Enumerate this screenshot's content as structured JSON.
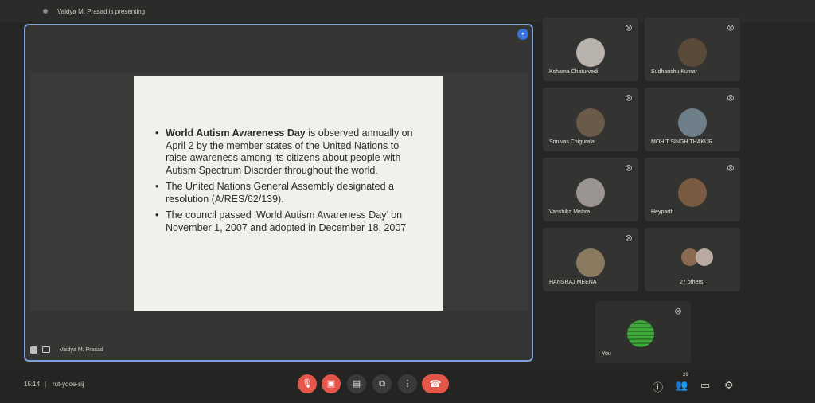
{
  "header": {
    "presenting_text": "Vaidya M. Prasad is presenting"
  },
  "presentation": {
    "badge_text": "+",
    "bullets": [
      {
        "bold": "World Autism Awareness Day",
        "text": " is observed annually on April 2 by the member states of the United Nations to raise awareness among its citizens about people with Autism Spectrum Disorder throughout the world."
      },
      {
        "bold": "",
        "text": "The United Nations General Assembly designated a resolution (A/RES/62/139)."
      },
      {
        "bold": "",
        "text": "The council passed ‘World Autism Awareness Day’ on November 1, 2007 and adopted in December 18, 2007"
      }
    ],
    "presenter_name": "Vaidya M. Prasad"
  },
  "participants": [
    {
      "name": "Kshama Chaturvedi",
      "avatar_color": "#b8b2ac"
    },
    {
      "name": "Sudhanshu Kumar",
      "avatar_color": "#5a4a3a"
    },
    {
      "name": "Srinivas Chigurala",
      "avatar_color": "#6a5a4a"
    },
    {
      "name": "MOHIT SINGH THAKUR",
      "avatar_color": "#6f7f8a"
    },
    {
      "name": "Vanshika Mishra",
      "avatar_color": "#9a9590"
    },
    {
      "name": "Heyparth",
      "avatar_color": "#7a5a40"
    },
    {
      "name": "HANSRAJ MEENA",
      "avatar_color": "#8a7a60"
    },
    {
      "name": "27 others",
      "avatar_color": "#8a6a50"
    }
  ],
  "self_tile": {
    "name": "You"
  },
  "footer": {
    "time": "15:14",
    "separator": "|",
    "meeting_code": "rut-yqoe-sij",
    "participant_count": "29",
    "icons": {
      "mic": "mic-off-icon",
      "camera": "camera-off-icon",
      "captions": "captions-icon",
      "present": "present-icon",
      "more": "more-icon",
      "end": "end-call-icon",
      "info": "info-icon",
      "people": "people-icon",
      "chat": "chat-icon",
      "activities": "activities-icon"
    },
    "colors": {
      "danger": "#e5564a",
      "accent": "#7ea0d8"
    }
  }
}
